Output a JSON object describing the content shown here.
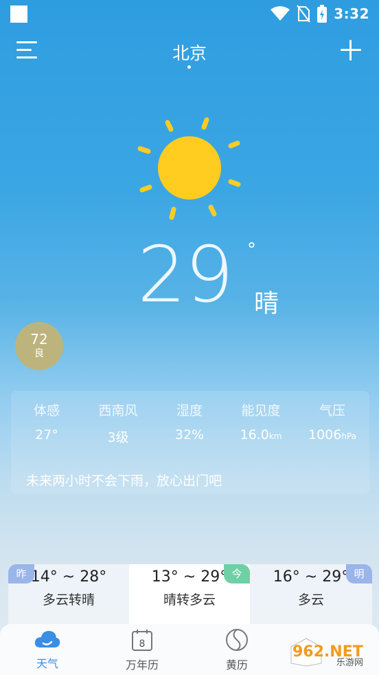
{
  "status_bar": {
    "time": "3:32"
  },
  "header": {
    "city": "北京"
  },
  "current": {
    "temperature": "29",
    "degree_symbol": "°",
    "condition": "晴"
  },
  "aqi": {
    "value": "72",
    "level": "良"
  },
  "details": [
    {
      "label": "体感",
      "value": "27°",
      "unit": ""
    },
    {
      "label": "西南风",
      "value": "3级",
      "unit": ""
    },
    {
      "label": "湿度",
      "value": "32%",
      "unit": ""
    },
    {
      "label": "能见度",
      "value": "16.0",
      "unit": "km"
    },
    {
      "label": "气压",
      "value": "1006",
      "unit": "hPa"
    }
  ],
  "rain_forecast": "未来两小时不会下雨，放心出门吧",
  "forecast": [
    {
      "tag": "昨",
      "temp": "14° ~ 28°",
      "desc": "多云转晴",
      "tag_color": "#9ab5ea"
    },
    {
      "tag": "今",
      "temp": "13° ~ 29°",
      "desc": "晴转多云",
      "tag_color": "#6fd0a6"
    },
    {
      "tag": "明",
      "temp": "16° ~ 29°",
      "desc": "多云",
      "tag_color": "#9ab5ea"
    }
  ],
  "nav": {
    "tabs": [
      {
        "label": "天气",
        "icon": "cloud-icon"
      },
      {
        "label": "万年历",
        "icon": "calendar-icon",
        "date": "8"
      },
      {
        "label": "黄历",
        "icon": "yin-yang-icon"
      }
    ]
  },
  "watermark": {
    "text": "962.NET",
    "subtext": "乐游网"
  },
  "colors": {
    "accent": "#3a8ee6",
    "sun": "#ffcc1f",
    "aqi": "#bdb47d"
  }
}
